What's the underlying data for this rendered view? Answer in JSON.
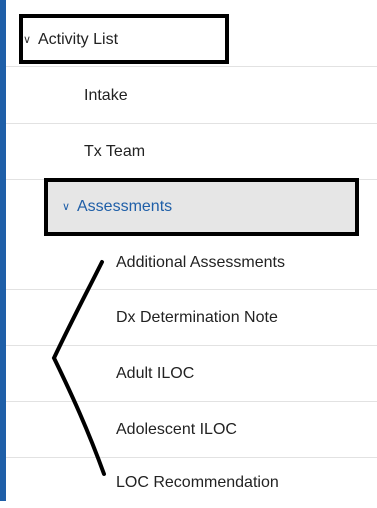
{
  "nav": {
    "root": {
      "label": "Activity List",
      "expanded": true,
      "icon": "chevron-down-icon"
    },
    "items": [
      {
        "label": "Intake"
      },
      {
        "label": "Tx Team"
      }
    ],
    "selected": {
      "label": "Assessments",
      "expanded": true,
      "icon": "chevron-down-icon"
    },
    "sub_items": [
      {
        "label": "Additional Assessments"
      },
      {
        "label": "Dx Determination Note"
      },
      {
        "label": "Adult ILOC"
      },
      {
        "label": "Adolescent ILOC"
      },
      {
        "label": "LOC Recommendation"
      }
    ]
  },
  "colors": {
    "accent": "#1f5fa8",
    "selected_bg": "#e6e6e6",
    "annotation": "#000000"
  }
}
